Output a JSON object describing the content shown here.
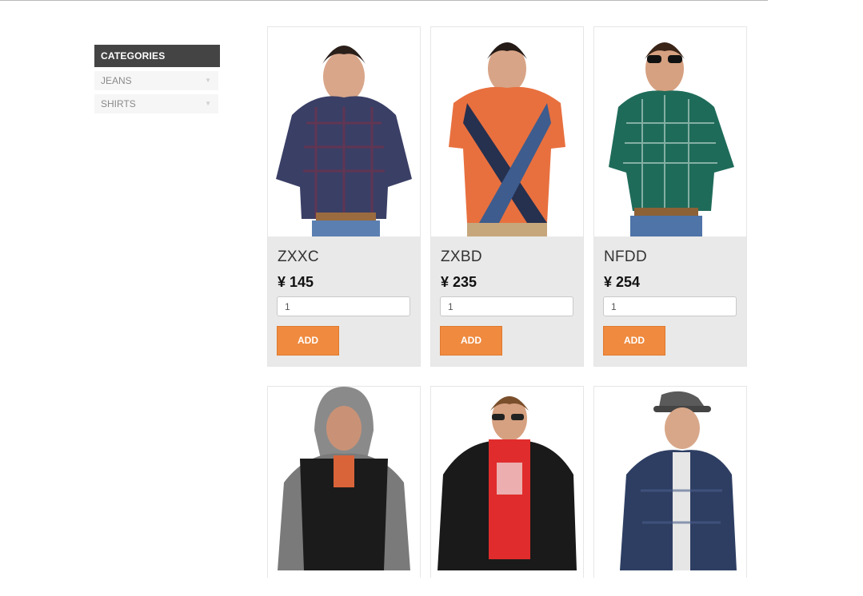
{
  "sidebar": {
    "title": "CATEGORIES",
    "items": [
      {
        "label": "JEANS",
        "icon": "caret-down-icon"
      },
      {
        "label": "SHIRTS",
        "icon": "caret-down-icon"
      }
    ]
  },
  "products": [
    {
      "name": "ZXXC",
      "price": "¥ 145",
      "quantity": "1",
      "add_label": "ADD",
      "shirt_color": "#3a3f66"
    },
    {
      "name": "ZXBD",
      "price": "¥ 235",
      "quantity": "1",
      "add_label": "ADD",
      "shirt_color": "#e8703f"
    },
    {
      "name": "NFDD",
      "price": "¥ 254",
      "quantity": "1",
      "add_label": "ADD",
      "shirt_color": "#1f6b5a"
    },
    {
      "name": "",
      "price": "",
      "quantity": "",
      "add_label": "",
      "shirt_color": "#1b1b1b"
    },
    {
      "name": "",
      "price": "",
      "quantity": "",
      "add_label": "",
      "shirt_color": "#1a1a1a"
    },
    {
      "name": "",
      "price": "",
      "quantity": "",
      "add_label": "",
      "shirt_color": "#2e3e63"
    }
  ],
  "colors": {
    "accent": "#ef8a3f",
    "sidebar_header": "#444444",
    "card_bg": "#e9e9e9"
  }
}
